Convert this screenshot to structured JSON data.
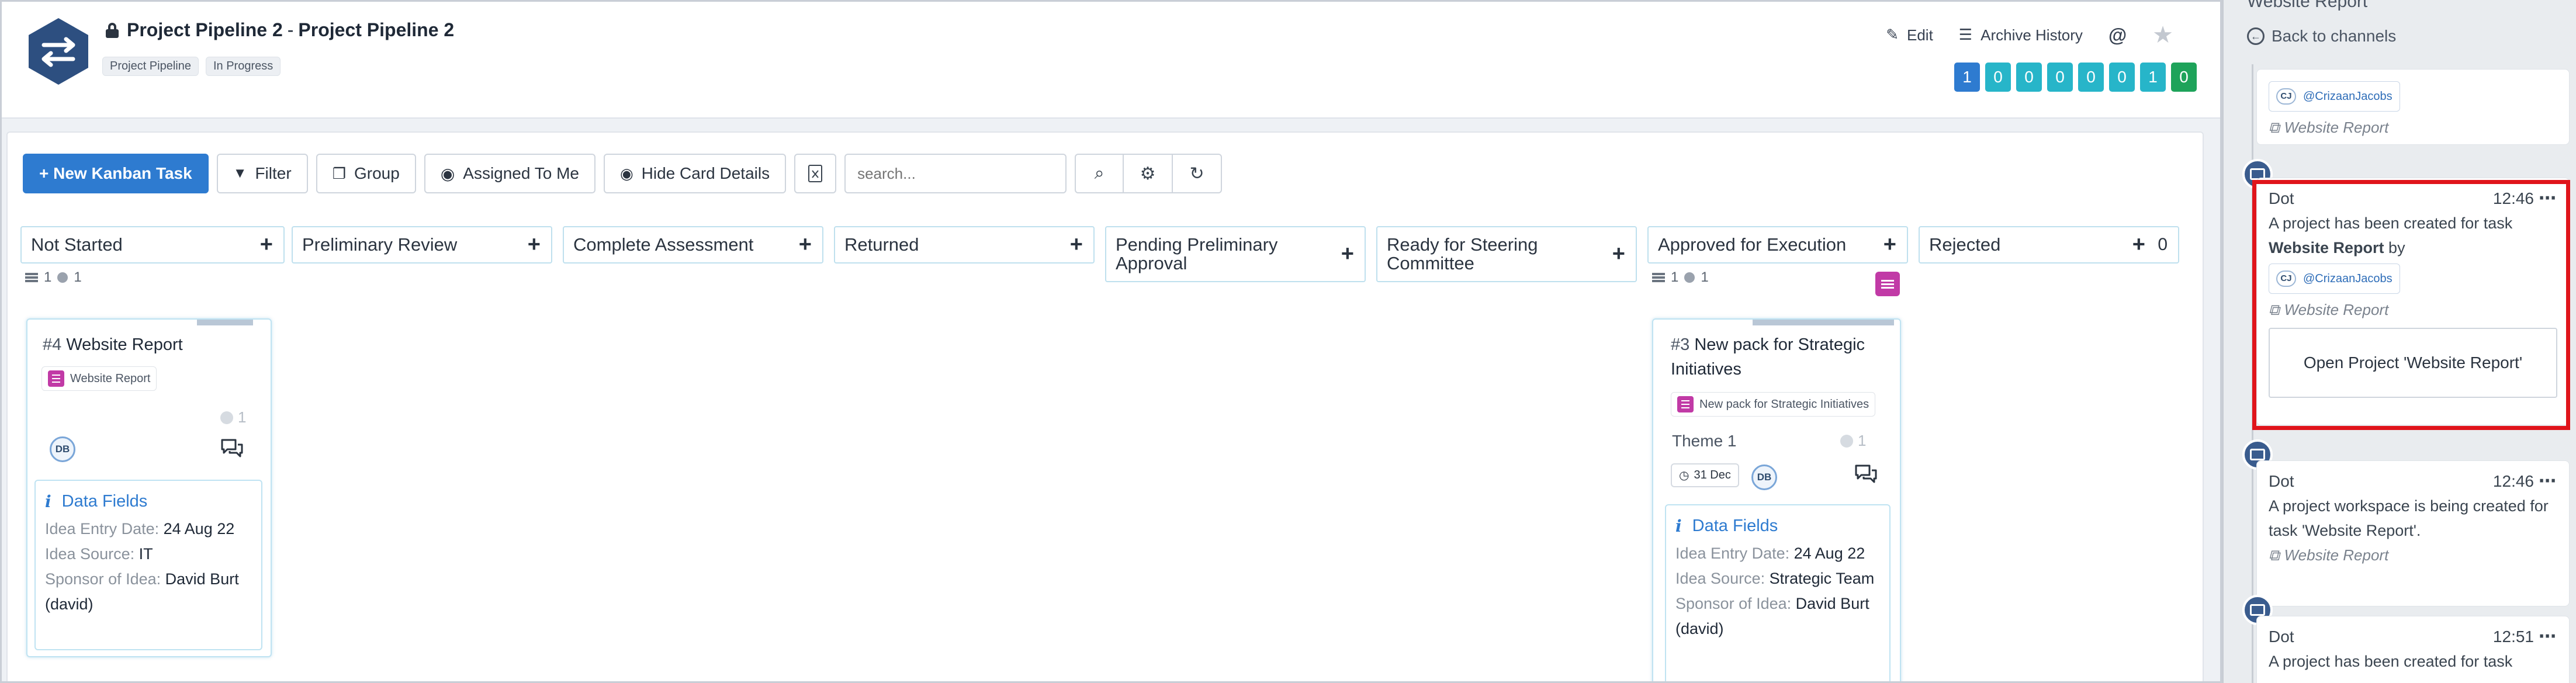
{
  "header": {
    "title": "Project Pipeline 2",
    "title_separator": "-",
    "subtitle": "Project Pipeline 2",
    "tags": [
      "Project Pipeline",
      "In Progress"
    ],
    "edit_label": "Edit",
    "archive_label": "Archive History",
    "at_symbol": "@",
    "counts": [
      {
        "value": "1",
        "color": "#2e7bd0"
      },
      {
        "value": "0",
        "color": "#27b5c9"
      },
      {
        "value": "0",
        "color": "#27b5c9"
      },
      {
        "value": "0",
        "color": "#27b5c9"
      },
      {
        "value": "0",
        "color": "#27b5c9"
      },
      {
        "value": "0",
        "color": "#27b5c9"
      },
      {
        "value": "1",
        "color": "#27b5c9"
      },
      {
        "value": "0",
        "color": "#1ea35a"
      }
    ]
  },
  "toolbar": {
    "new_task": "+ New Kanban Task",
    "filter": "Filter",
    "group": "Group",
    "assigned": "Assigned To Me",
    "hide_details": "Hide Card Details",
    "search_placeholder": "search..."
  },
  "columns": [
    {
      "name": "Not Started",
      "meta_count": "1",
      "meta_count2": "1"
    },
    {
      "name": "Preliminary Review"
    },
    {
      "name": "Complete Assessment"
    },
    {
      "name": "Returned"
    },
    {
      "name": "Pending Preliminary Approval"
    },
    {
      "name": "Ready for Steering Committee"
    },
    {
      "name": "Approved for Execution",
      "meta_count": "1",
      "meta_count2": "1"
    },
    {
      "name": "Rejected",
      "count": "0"
    }
  ],
  "cards": {
    "card1": {
      "num": "#4",
      "title": "Website Report",
      "chip": "Website Report",
      "dot_count": "1",
      "avatar": "DB",
      "df_title": "Data Fields",
      "fields": [
        {
          "label": "Idea Entry Date:",
          "value": "24 Aug 22"
        },
        {
          "label": "Idea Source:",
          "value": "IT"
        },
        {
          "label": "Sponsor of Idea:",
          "value": "David Burt (david)"
        }
      ]
    },
    "card2": {
      "num": "#3",
      "title": "New pack for Strategic Initiatives",
      "chip": "New pack for Strategic Initiatives",
      "theme": "Theme 1",
      "dot_count": "1",
      "date": "31 Dec",
      "avatar": "DB",
      "df_title": "Data Fields",
      "fields": [
        {
          "label": "Idea Entry Date:",
          "value": "24 Aug 22"
        },
        {
          "label": "Idea Source:",
          "value": "Strategic Team"
        },
        {
          "label": "Sponsor of Idea:",
          "value": "David Burt (david)"
        }
      ]
    }
  },
  "panel": {
    "title": "Website Report",
    "back": "Back to channels",
    "top_user": "@CrizaanJacobs",
    "top_user_initials": "CJ",
    "top_link": "Website Report",
    "msg1": {
      "who": "Dot",
      "time": "12:46",
      "text_a": "A project has been created for task",
      "text_b": "Website Report",
      "text_c": "by",
      "user": "@CrizaanJacobs",
      "user_initials": "CJ",
      "link": "Website Report",
      "button": "Open Project 'Website Report'"
    },
    "msg2": {
      "who": "Dot",
      "time": "12:46",
      "text": "A project workspace is being created for task 'Website Report'.",
      "link": "Website Report"
    },
    "msg3": {
      "who": "Dot",
      "time": "12:51",
      "text": "A project has been created for task"
    }
  }
}
